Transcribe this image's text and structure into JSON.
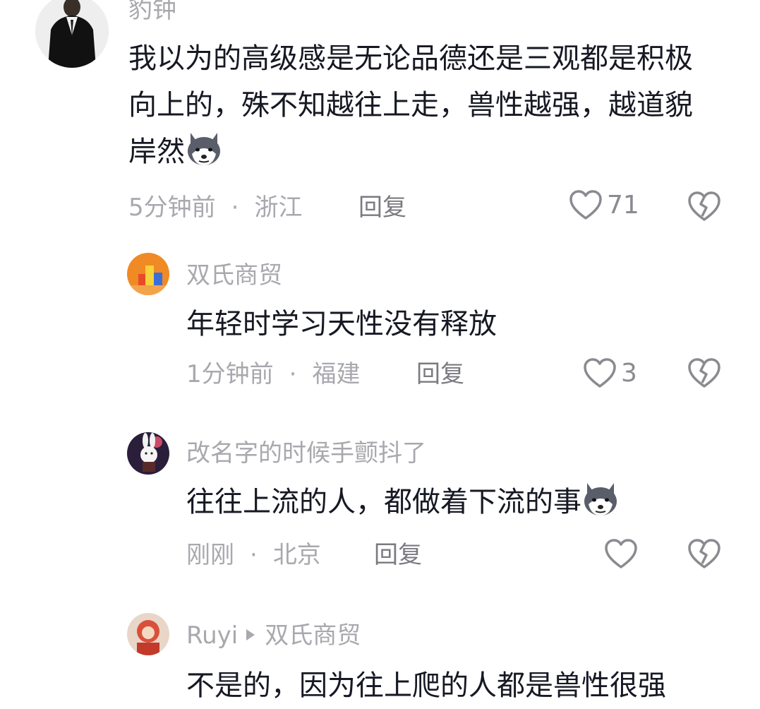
{
  "comments": [
    {
      "username": "豹钟",
      "content": "我以为的高级感是无论品德还是三观都是积极向上的，殊不知越往上走，兽性越强，越道貌岸然",
      "time": "5分钟前",
      "location": "浙江",
      "reply_label": "回复",
      "likes": "71",
      "emoji": "husky-dog-emoji"
    },
    {
      "username": "双氏商贸",
      "content": "年轻时学习天性没有释放",
      "time": "1分钟前",
      "location": "福建",
      "reply_label": "回复",
      "likes": "3"
    },
    {
      "username": "改名字的时候手颤抖了",
      "content": "往往上流的人，都做着下流的事",
      "time": "刚刚",
      "location": "北京",
      "reply_label": "回复",
      "likes": "",
      "emoji": "husky-dog-emoji"
    },
    {
      "username": "Ruyi",
      "reply_to": "双氏商贸",
      "content": "不是的，因为往上爬的人都是兽性很强"
    }
  ],
  "separator": "·",
  "colors": {
    "text": "#161823",
    "meta": "#a8a8ae",
    "icon": "#8a8a90"
  }
}
